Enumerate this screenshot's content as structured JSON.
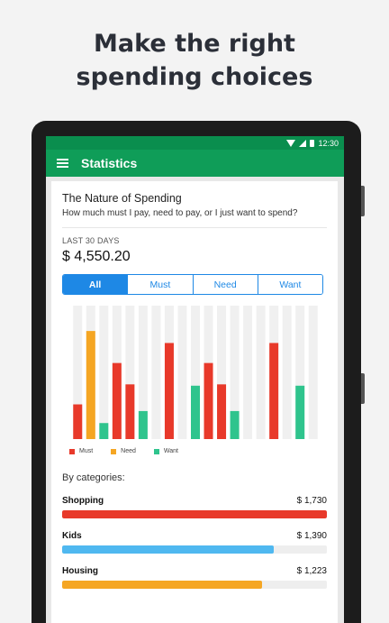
{
  "headline": [
    "Make the right",
    "spending choices"
  ],
  "status": {
    "time": "12:30"
  },
  "appbar": {
    "title": "Statistics"
  },
  "card": {
    "title": "The Nature of Spending",
    "subtitle": "How much must I pay, need to pay, or I just want to spend?",
    "period_label": "LAST 30 DAYS",
    "total": "$ 4,550.20"
  },
  "segments": [
    "All",
    "Must",
    "Need",
    "Want"
  ],
  "active_segment": "All",
  "colors": {
    "must": "#e8392a",
    "need": "#f5a623",
    "want": "#2fc48d",
    "kids": "#4fb8f0",
    "accent": "#1e88e5",
    "brand": "#0f9d58"
  },
  "chart_data": {
    "type": "bar",
    "x": [
      1,
      2,
      3,
      4,
      5,
      6,
      7,
      8,
      9,
      10,
      11,
      12,
      13,
      14,
      15,
      16,
      17,
      18,
      19
    ],
    "ylim": [
      0,
      1
    ],
    "series": [
      {
        "name": "Must",
        "color": "#e8392a",
        "values": [
          0.26,
          0,
          0,
          0.57,
          0.41,
          0,
          0,
          0.72,
          0,
          0,
          0.57,
          0.41,
          0,
          0,
          0,
          0.72,
          0,
          0,
          0
        ]
      },
      {
        "name": "Need",
        "color": "#f5a623",
        "values": [
          0,
          0.81,
          0,
          0,
          0,
          0,
          0,
          0,
          0,
          0,
          0,
          0,
          0,
          0,
          0,
          0,
          0,
          0,
          0
        ]
      },
      {
        "name": "Want",
        "color": "#2fc48d",
        "values": [
          0,
          0,
          0.12,
          0,
          0,
          0.21,
          0,
          0,
          0,
          0.4,
          0,
          0,
          0.21,
          0,
          0,
          0,
          0,
          0.4,
          0
        ]
      }
    ]
  },
  "legend": [
    {
      "label": "Must",
      "color": "#e8392a"
    },
    {
      "label": "Need",
      "color": "#f5a623"
    },
    {
      "label": "Want",
      "color": "#2fc48d"
    }
  ],
  "categories_title": "By categories:",
  "categories": [
    {
      "name": "Shopping",
      "amount": "$ 1,730",
      "fraction": 1.0,
      "color": "#e8392a"
    },
    {
      "name": "Kids",
      "amount": "$ 1,390",
      "fraction": 0.8,
      "color": "#4fb8f0"
    },
    {
      "name": "Housing",
      "amount": "$ 1,223",
      "fraction": 0.755,
      "color": "#f5a623"
    }
  ]
}
